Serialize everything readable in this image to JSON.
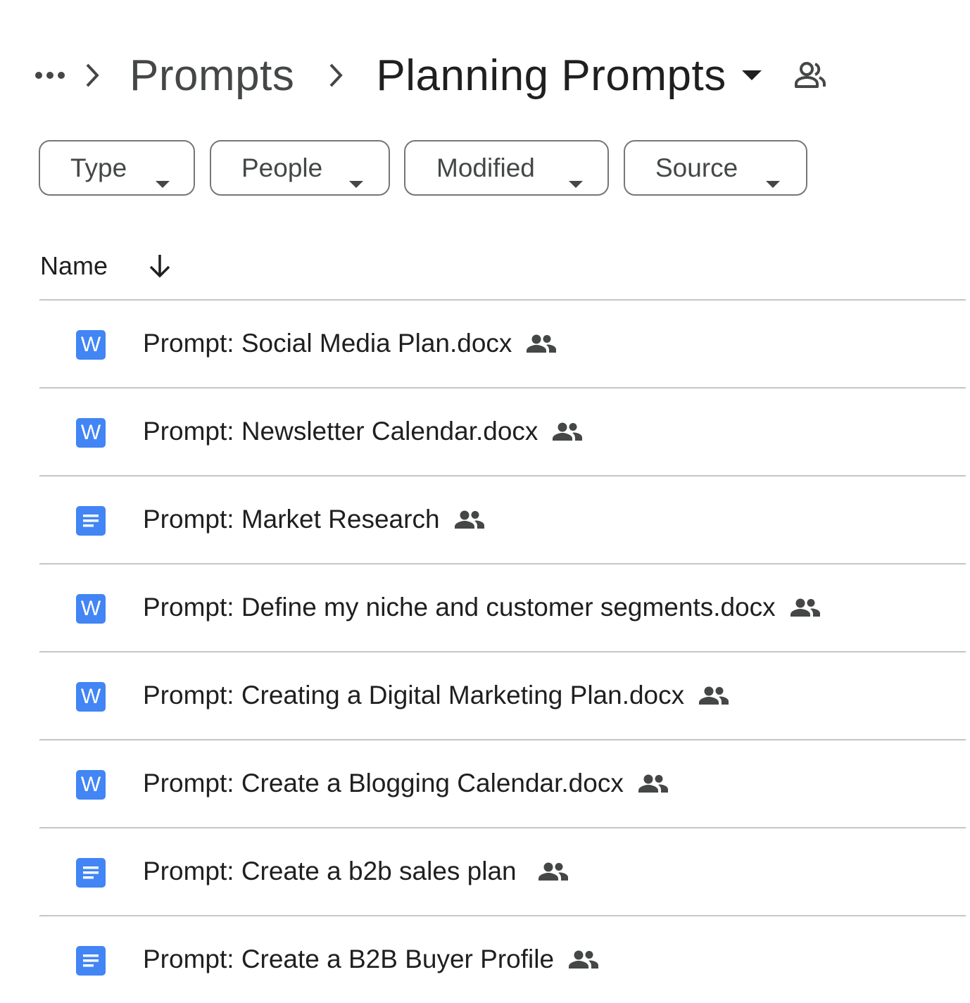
{
  "breadcrumb": {
    "more_label": "...",
    "parent": "Prompts",
    "current": "Planning Prompts"
  },
  "filters": [
    {
      "label": "Type"
    },
    {
      "label": "People"
    },
    {
      "label": "Modified"
    },
    {
      "label": "Source"
    }
  ],
  "list_header": {
    "name_column": "Name",
    "sort_direction": "descending"
  },
  "files": [
    {
      "name": "Prompt: Social Media Plan.docx",
      "type": "word",
      "icon_letter": "W",
      "shared": true
    },
    {
      "name": "Prompt: Newsletter Calendar.docx",
      "type": "word",
      "icon_letter": "W",
      "shared": true
    },
    {
      "name": "Prompt: Market Research",
      "type": "google-doc",
      "shared": true
    },
    {
      "name": "Prompt: Define my niche and customer segments.docx",
      "type": "word",
      "icon_letter": "W",
      "shared": true
    },
    {
      "name": "Prompt: Creating a Digital Marketing Plan.docx",
      "type": "word",
      "icon_letter": "W",
      "shared": true
    },
    {
      "name": "Prompt: Create a Blogging Calendar.docx",
      "type": "word",
      "icon_letter": "W",
      "shared": true
    },
    {
      "name": "Prompt: Create a b2b sales plan",
      "type": "google-doc",
      "shared": true
    },
    {
      "name": "Prompt: Create a B2B Buyer Profile",
      "type": "google-doc",
      "shared": true
    }
  ],
  "colors": {
    "doc_blue": "#4285f4",
    "text_primary": "#1f1f1f",
    "text_secondary": "#444746",
    "divider": "#c4c7c5"
  }
}
